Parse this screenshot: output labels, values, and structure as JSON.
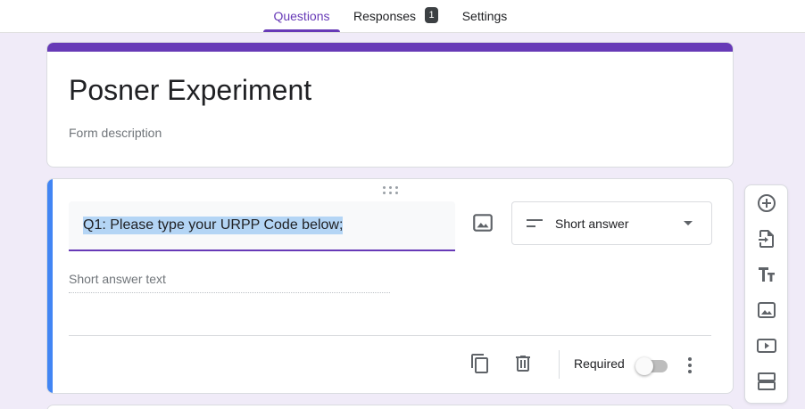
{
  "tabs": {
    "questions": "Questions",
    "responses": "Responses",
    "responses_count": "1",
    "settings": "Settings"
  },
  "form": {
    "title": "Posner Experiment",
    "description_placeholder": "Form description"
  },
  "question": {
    "text": "Q1: Please type your URPP Code below;",
    "type": "Short answer",
    "answer_placeholder": "Short answer text",
    "required_label": "Required",
    "required": false
  },
  "colors": {
    "accent": "#673ab7",
    "active_card": "#4285f4",
    "background": "#f0ebf8"
  },
  "icons": {
    "question_image": "image-icon",
    "duplicate": "copy-icon",
    "delete": "trash-icon",
    "more": "more-vert-icon",
    "toolbar": [
      "add-circle-icon",
      "import-icon",
      "title-text-icon",
      "image-icon",
      "video-icon",
      "section-icon"
    ]
  }
}
